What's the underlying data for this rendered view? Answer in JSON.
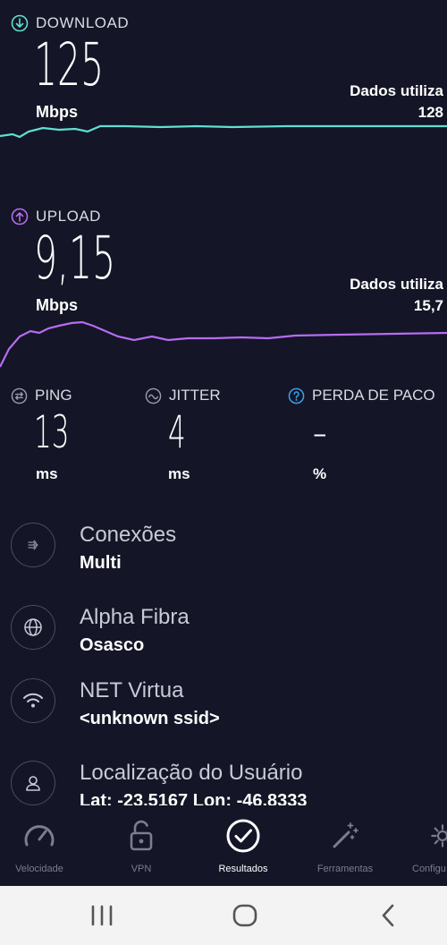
{
  "download": {
    "label": "DOWNLOAD",
    "value": "125",
    "unit": "Mbps",
    "data_used_label": "Dados utiliza",
    "data_used_value": "128",
    "accent": "#5fe0d0"
  },
  "upload": {
    "label": "UPLOAD",
    "value": "9,15",
    "unit": "Mbps",
    "data_used_label": "Dados utiliza",
    "data_used_value": "15,7",
    "accent": "#b66cf0"
  },
  "metrics": {
    "ping": {
      "label": "PING",
      "value": "13",
      "unit": "ms"
    },
    "jitter": {
      "label": "JITTER",
      "value": "4",
      "unit": "ms"
    },
    "loss": {
      "label": "PERDA DE PACO",
      "value": "–",
      "unit": "%"
    }
  },
  "info": {
    "connections": {
      "title": "Conexões",
      "sub": "Multi",
      "icon": "connections-icon"
    },
    "provider": {
      "title": "Alpha Fibra",
      "sub": "Osasco",
      "icon": "globe-icon"
    },
    "network": {
      "title": "NET Virtua",
      "sub": "<unknown ssid>",
      "icon": "wifi-icon"
    },
    "location": {
      "title": "Localização do Usuário",
      "sub": "Lat: -23.5167 Lon: -46.8333",
      "icon": "user-icon"
    }
  },
  "tabs": [
    {
      "label": "Velocidade",
      "icon": "speedometer-icon"
    },
    {
      "label": "VPN",
      "icon": "lock-icon"
    },
    {
      "label": "Resultados",
      "icon": "check-circle-icon",
      "active": true
    },
    {
      "label": "Ferramentas",
      "icon": "magic-wand-icon"
    },
    {
      "label": "Configu",
      "icon": "gear-icon"
    }
  ],
  "colors": {
    "background": "#141526",
    "download": "#5fe0d0",
    "upload": "#b66cf0",
    "help": "#3aa0e8"
  }
}
